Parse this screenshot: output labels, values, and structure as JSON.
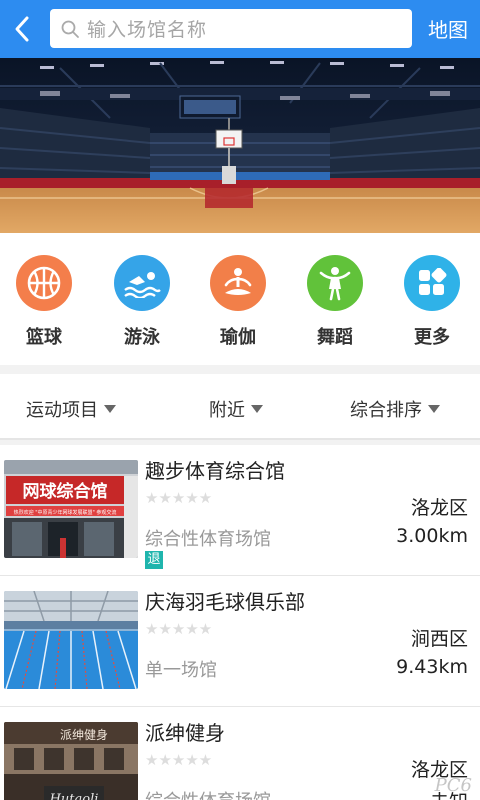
{
  "header": {
    "back_icon": "chevron-left-icon",
    "search_placeholder": "输入场馆名称",
    "map_label": "地图"
  },
  "categories": [
    {
      "label": "篮球",
      "icon": "basketball-icon",
      "color": "#f47e4b"
    },
    {
      "label": "游泳",
      "icon": "swimmer-icon",
      "color": "#35a4e8"
    },
    {
      "label": "瑜伽",
      "icon": "yoga-icon",
      "color": "#f27f49"
    },
    {
      "label": "舞蹈",
      "icon": "dancer-icon",
      "color": "#61c23a"
    },
    {
      "label": "更多",
      "icon": "grid-more-icon",
      "color": "#2fb2e8"
    }
  ],
  "filters": {
    "sport": "运动项目",
    "nearby": "附近",
    "sort": "综合排序"
  },
  "venues": [
    {
      "name": "趣步体育综合馆",
      "stars": "★★★★★",
      "district": "洛龙区",
      "type": "综合性体育场馆",
      "distance": "3.00km",
      "badge": "退",
      "thumb_text": "网球综合馆",
      "thumb_sub": "热烈欢迎 \"中原青少年网球发展联盟\" 参观交流"
    },
    {
      "name": "庆海羽毛球俱乐部",
      "stars": "★★★★★",
      "district": "涧西区",
      "type": "单一场馆",
      "distance": "9.43km"
    },
    {
      "name": "派绅健身",
      "stars": "★★★★★",
      "district": "洛龙区",
      "type": "综合性体育场馆",
      "distance": "未知",
      "thumb_text": "派绅健身",
      "thumb_sub": "Hutaoli"
    }
  ],
  "watermark": "PC6"
}
